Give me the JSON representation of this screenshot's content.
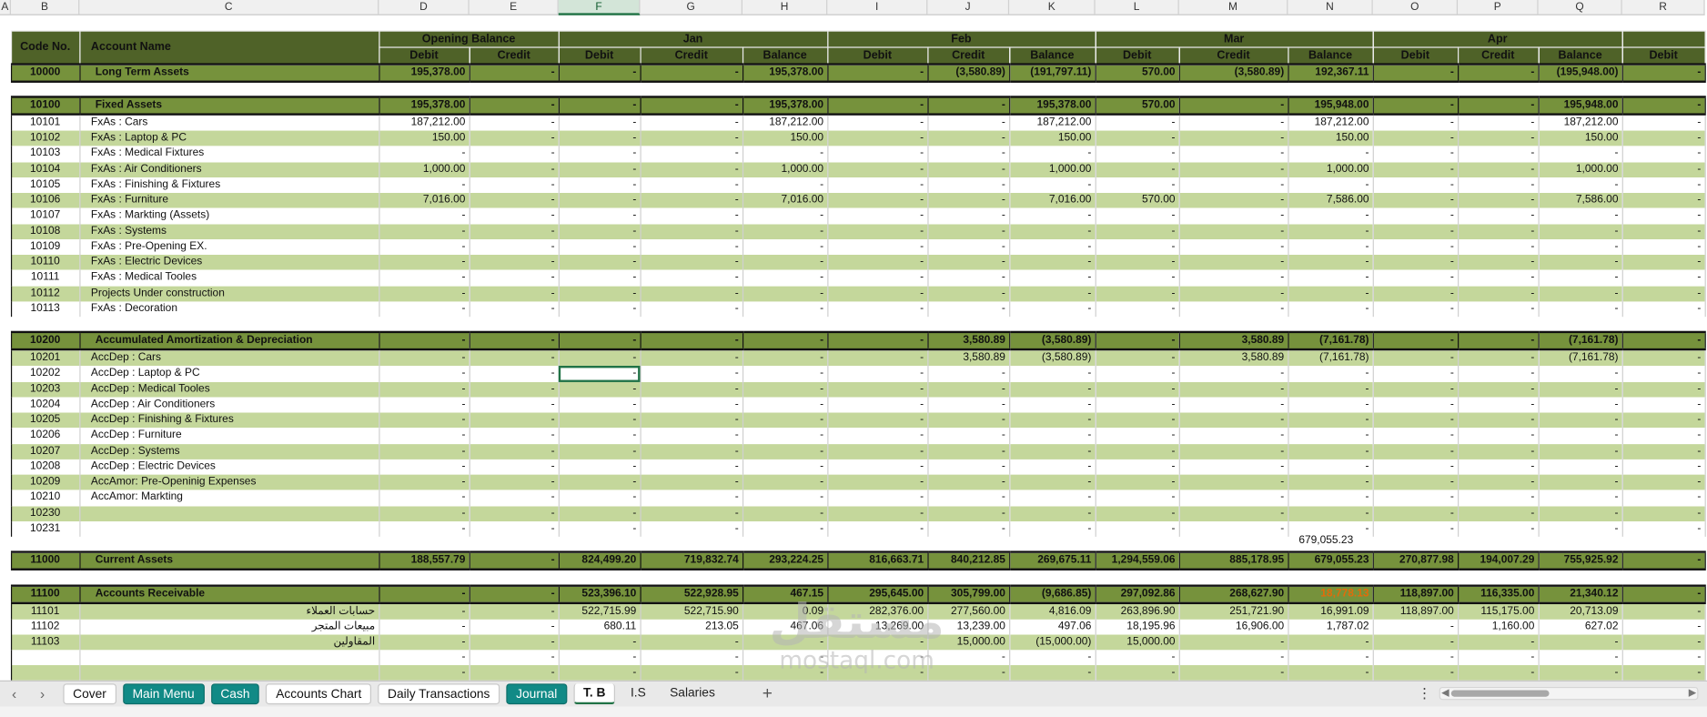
{
  "column_letters": [
    "A",
    "B",
    "C",
    "D",
    "E",
    "F",
    "G",
    "H",
    "I",
    "J",
    "K",
    "L",
    "M",
    "N",
    "O",
    "P",
    "Q",
    "R"
  ],
  "selected_column": "F",
  "header": {
    "code": "Code No.",
    "name": "Account Name",
    "groups": [
      "Opening Balance",
      "Jan",
      "Feb",
      "Mar",
      "Apr"
    ],
    "debit": "Debit",
    "credit": "Credit",
    "balance": "Balance"
  },
  "sections": [
    {
      "type": "sec",
      "code": "10000",
      "name": "Long Term Assets",
      "v": [
        "195,378.00",
        "-",
        "-",
        "-",
        "195,378.00",
        "-",
        "(3,580.89)",
        "(191,797.11)",
        "570.00",
        "(3,580.89)",
        "192,367.11",
        "-",
        "-",
        "(195,948.00)",
        "-"
      ]
    },
    {
      "type": "blank"
    },
    {
      "type": "sec",
      "code": "10100",
      "name": "Fixed Assets",
      "v": [
        "195,378.00",
        "-",
        "-",
        "-",
        "195,378.00",
        "-",
        "-",
        "195,378.00",
        "570.00",
        "-",
        "195,948.00",
        "-",
        "-",
        "195,948.00",
        "-"
      ]
    },
    {
      "type": "row",
      "code": "10101",
      "name": "FxAs : Cars",
      "v": [
        "187,212.00",
        "-",
        "-",
        "-",
        "187,212.00",
        "-",
        "-",
        "187,212.00",
        "-",
        "-",
        "187,212.00",
        "-",
        "-",
        "187,212.00",
        "-"
      ]
    },
    {
      "type": "row",
      "code": "10102",
      "name": "FxAs : Laptop & PC",
      "v": [
        "150.00",
        "-",
        "-",
        "-",
        "150.00",
        "-",
        "-",
        "150.00",
        "-",
        "-",
        "150.00",
        "-",
        "-",
        "150.00",
        "-"
      ]
    },
    {
      "type": "row",
      "code": "10103",
      "name": "FxAs : Medical Fixtures",
      "v": [
        "-",
        "-",
        "-",
        "-",
        "-",
        "-",
        "-",
        "-",
        "-",
        "-",
        "-",
        "-",
        "-",
        "-",
        "-"
      ]
    },
    {
      "type": "row",
      "code": "10104",
      "name": "FxAs : Air Conditioners",
      "v": [
        "1,000.00",
        "-",
        "-",
        "-",
        "1,000.00",
        "-",
        "-",
        "1,000.00",
        "-",
        "-",
        "1,000.00",
        "-",
        "-",
        "1,000.00",
        "-"
      ]
    },
    {
      "type": "row",
      "code": "10105",
      "name": "FxAs : Finishing & Fixtures",
      "v": [
        "-",
        "-",
        "-",
        "-",
        "-",
        "-",
        "-",
        "-",
        "-",
        "-",
        "-",
        "-",
        "-",
        "-",
        "-"
      ]
    },
    {
      "type": "row",
      "code": "10106",
      "name": "FxAs : Furniture",
      "v": [
        "7,016.00",
        "-",
        "-",
        "-",
        "7,016.00",
        "-",
        "-",
        "7,016.00",
        "570.00",
        "-",
        "7,586.00",
        "-",
        "-",
        "7,586.00",
        "-"
      ]
    },
    {
      "type": "row",
      "code": "10107",
      "name": "FxAs : Markting (Assets)",
      "v": [
        "-",
        "-",
        "-",
        "-",
        "-",
        "-",
        "-",
        "-",
        "-",
        "-",
        "-",
        "-",
        "-",
        "-",
        "-"
      ]
    },
    {
      "type": "row",
      "code": "10108",
      "name": "FxAs : Systems",
      "v": [
        "-",
        "-",
        "-",
        "-",
        "-",
        "-",
        "-",
        "-",
        "-",
        "-",
        "-",
        "-",
        "-",
        "-",
        "-"
      ]
    },
    {
      "type": "row",
      "code": "10109",
      "name": "FxAs : Pre-Opening EX.",
      "v": [
        "-",
        "-",
        "-",
        "-",
        "-",
        "-",
        "-",
        "-",
        "-",
        "-",
        "-",
        "-",
        "-",
        "-",
        "-"
      ]
    },
    {
      "type": "row",
      "code": "10110",
      "name": "FxAs : Electric Devices",
      "v": [
        "-",
        "-",
        "-",
        "-",
        "-",
        "-",
        "-",
        "-",
        "-",
        "-",
        "-",
        "-",
        "-",
        "-",
        "-"
      ]
    },
    {
      "type": "row",
      "code": "10111",
      "name": "FxAs : Medical Tooles",
      "v": [
        "-",
        "-",
        "-",
        "-",
        "-",
        "-",
        "-",
        "-",
        "-",
        "-",
        "-",
        "-",
        "-",
        "-",
        "-"
      ]
    },
    {
      "type": "row",
      "code": "10112",
      "name": "Projects Under construction",
      "v": [
        "-",
        "-",
        "-",
        "-",
        "-",
        "-",
        "-",
        "-",
        "-",
        "-",
        "-",
        "-",
        "-",
        "-",
        "-"
      ]
    },
    {
      "type": "row",
      "code": "10113",
      "name": "FxAs : Decoration",
      "v": [
        "-",
        "-",
        "-",
        "-",
        "-",
        "-",
        "-",
        "-",
        "-",
        "-",
        "-",
        "-",
        "-",
        "-",
        "-"
      ]
    },
    {
      "type": "blank"
    },
    {
      "type": "sec",
      "code": "10200",
      "name": "Accumulated Amortization & Depreciation",
      "v": [
        "-",
        "-",
        "-",
        "-",
        "-",
        "-",
        "3,580.89",
        "(3,580.89)",
        "-",
        "3,580.89",
        "(7,161.78)",
        "-",
        "-",
        "(7,161.78)",
        "-"
      ]
    },
    {
      "type": "row",
      "code": "10201",
      "name": "AccDep : Cars",
      "v": [
        "-",
        "-",
        "-",
        "-",
        "-",
        "-",
        "3,580.89",
        "(3,580.89)",
        "-",
        "3,580.89",
        "(7,161.78)",
        "-",
        "-",
        "(7,161.78)",
        "-"
      ]
    },
    {
      "type": "row",
      "code": "10202",
      "name": "AccDep : Laptop & PC",
      "v": [
        "-",
        "-",
        "-",
        "-",
        "-",
        "-",
        "-",
        "-",
        "-",
        "-",
        "-",
        "-",
        "-",
        "-",
        "-"
      ],
      "sel": 2
    },
    {
      "type": "row",
      "code": "10203",
      "name": "AccDep : Medical Tooles",
      "v": [
        "-",
        "-",
        "-",
        "-",
        "-",
        "-",
        "-",
        "-",
        "-",
        "-",
        "-",
        "-",
        "-",
        "-",
        "-"
      ]
    },
    {
      "type": "row",
      "code": "10204",
      "name": "AccDep : Air Conditioners",
      "v": [
        "-",
        "-",
        "-",
        "-",
        "-",
        "-",
        "-",
        "-",
        "-",
        "-",
        "-",
        "-",
        "-",
        "-",
        "-"
      ]
    },
    {
      "type": "row",
      "code": "10205",
      "name": "AccDep : Finishing & Fixtures",
      "v": [
        "-",
        "-",
        "-",
        "-",
        "-",
        "-",
        "-",
        "-",
        "-",
        "-",
        "-",
        "-",
        "-",
        "-",
        "-"
      ]
    },
    {
      "type": "row",
      "code": "10206",
      "name": "AccDep : Furniture",
      "v": [
        "-",
        "-",
        "-",
        "-",
        "-",
        "-",
        "-",
        "-",
        "-",
        "-",
        "-",
        "-",
        "-",
        "-",
        "-"
      ]
    },
    {
      "type": "row",
      "code": "10207",
      "name": "AccDep : Systems",
      "v": [
        "-",
        "-",
        "-",
        "-",
        "-",
        "-",
        "-",
        "-",
        "-",
        "-",
        "-",
        "-",
        "-",
        "-",
        "-"
      ]
    },
    {
      "type": "row",
      "code": "10208",
      "name": "AccDep : Electric Devices",
      "v": [
        "-",
        "-",
        "-",
        "-",
        "-",
        "-",
        "-",
        "-",
        "-",
        "-",
        "-",
        "-",
        "-",
        "-",
        "-"
      ]
    },
    {
      "type": "row",
      "code": "10209",
      "name": "AccAmor: Pre-Openinig Expenses",
      "v": [
        "-",
        "-",
        "-",
        "-",
        "-",
        "-",
        "-",
        "-",
        "-",
        "-",
        "-",
        "-",
        "-",
        "-",
        "-"
      ]
    },
    {
      "type": "row",
      "code": "10210",
      "name": "AccAmor: Markting",
      "v": [
        "-",
        "-",
        "-",
        "-",
        "-",
        "-",
        "-",
        "-",
        "-",
        "-",
        "-",
        "-",
        "-",
        "-",
        "-"
      ]
    },
    {
      "type": "row",
      "code": "10230",
      "name": "",
      "v": [
        "-",
        "-",
        "-",
        "-",
        "-",
        "-",
        "-",
        "-",
        "-",
        "-",
        "-",
        "-",
        "-",
        "-",
        "-"
      ]
    },
    {
      "type": "row",
      "code": "10231",
      "name": "",
      "v": [
        "-",
        "-",
        "-",
        "-",
        "-",
        "-",
        "-",
        "-",
        "-",
        "-",
        "-",
        "-",
        "-",
        "-",
        "-"
      ]
    },
    {
      "type": "blank"
    },
    {
      "type": "sec",
      "code": "11000",
      "name": "Current Assets",
      "v": [
        "188,557.79",
        "-",
        "824,499.20",
        "719,832.74",
        "293,224.25",
        "816,663.71",
        "840,212.85",
        "269,675.11",
        "1,294,559.06",
        "885,178.95",
        "679,055.23",
        "270,877.98",
        "194,007.29",
        "755,925.92",
        "-"
      ]
    },
    {
      "type": "blank"
    },
    {
      "type": "sec",
      "code": "11100",
      "name": "Accounts Receivable",
      "v": [
        "-",
        "-",
        "523,396.10",
        "522,928.95",
        "467.15",
        "295,645.00",
        "305,799.00",
        "(9,686.85)",
        "297,092.86",
        "268,627.90",
        "18,778.13",
        "118,897.00",
        "116,335.00",
        "21,340.12",
        "-"
      ],
      "neg": 10
    },
    {
      "type": "row",
      "code": "11101",
      "name": "حسابات العملاء",
      "rtl": true,
      "v": [
        "-",
        "-",
        "522,715.99",
        "522,715.90",
        "0.09",
        "282,376.00",
        "277,560.00",
        "4,816.09",
        "263,896.90",
        "251,721.90",
        "16,991.09",
        "118,897.00",
        "115,175.00",
        "20,713.09",
        "-"
      ]
    },
    {
      "type": "row",
      "code": "11102",
      "name": "مبيعات المتجر",
      "rtl": true,
      "v": [
        "-",
        "-",
        "680.11",
        "213.05",
        "467.06",
        "13,269.00",
        "13,239.00",
        "497.06",
        "18,195.96",
        "16,906.00",
        "1,787.02",
        "-",
        "1,160.00",
        "627.02",
        "-"
      ]
    },
    {
      "type": "row",
      "code": "11103",
      "name": "المقاولين",
      "rtl": true,
      "v": [
        "-",
        "-",
        "-",
        "-",
        "-",
        "-",
        "15,000.00",
        "(15,000.00)",
        "15,000.00",
        "-",
        "-",
        "-",
        "-",
        "-",
        "-"
      ]
    },
    {
      "type": "row",
      "code": "",
      "name": "",
      "v": [
        "-",
        "-",
        "-",
        "-",
        "-",
        "-",
        "-",
        "-",
        "-",
        "-",
        "-",
        "-",
        "-",
        "-",
        "-"
      ]
    },
    {
      "type": "row",
      "code": "",
      "name": "",
      "v": [
        "-",
        "-",
        "-",
        "-",
        "-",
        "-",
        "-",
        "-",
        "-",
        "-",
        "-",
        "-",
        "-",
        "-",
        "-"
      ]
    },
    {
      "type": "row",
      "code": "",
      "name": "",
      "v": [
        "-",
        "-",
        "-",
        "-",
        "-",
        "-",
        "-",
        "-",
        "-",
        "-",
        "-",
        "-",
        "-",
        "-",
        "-"
      ]
    },
    {
      "type": "row",
      "code": "",
      "name": "",
      "v": [
        "-",
        "-",
        "-",
        "-",
        "-",
        "-",
        "-",
        "-",
        "-",
        "-",
        "-",
        "-",
        "-",
        "-",
        "-"
      ]
    }
  ],
  "stray_value": "679,055.23",
  "watermark": {
    "arabic": "مستقل",
    "latin": "mostaql.com"
  },
  "tabs": [
    {
      "label": "Cover",
      "style": "plain"
    },
    {
      "label": "Main Menu",
      "style": "teal"
    },
    {
      "label": "Cash",
      "style": "teal"
    },
    {
      "label": "Accounts Chart",
      "style": "plain"
    },
    {
      "label": "Daily Transactions",
      "style": "plain"
    },
    {
      "label": "Journal",
      "style": "teal"
    },
    {
      "label": "T. B",
      "style": "active"
    },
    {
      "label": "I.S",
      "style": "flat"
    },
    {
      "label": "Salaries",
      "style": "flat"
    }
  ],
  "nav": {
    "prev": "‹",
    "next": "›",
    "add": "+",
    "more": "⋮"
  }
}
